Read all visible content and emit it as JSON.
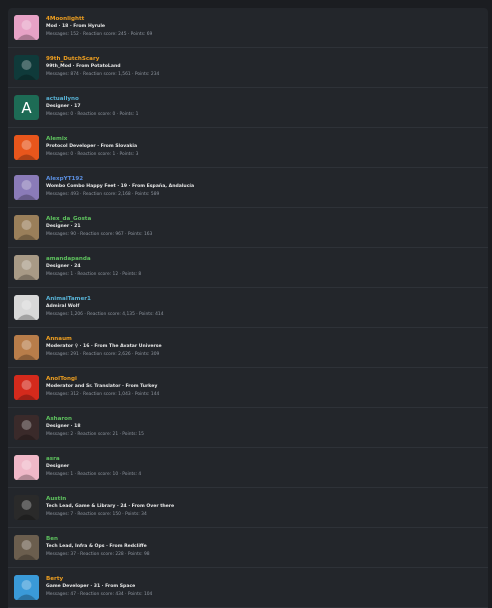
{
  "members": [
    {
      "name": "4Moonlightt",
      "name_color": "#f0a020",
      "title": "Mod · 18 · From Hyrule",
      "stats": "Messages: 152 · Reaction score: 245 · Points: 69",
      "avatar_icon": "anime-girl-pink-avatar",
      "avatar_color": "#e7a2c6"
    },
    {
      "name": "99th_DutchScary",
      "name_color": "#f0a020",
      "title": "99th_Mod · From PotatoLand",
      "stats": "Messages: 874 · Reaction score: 1,561 · Points: 234",
      "avatar_icon": "cheshire-cat-avatar",
      "avatar_color": "#0f3a3a"
    },
    {
      "name": "actuallyno",
      "name_color": "#58b3d6",
      "title": "Designer · 17",
      "stats": "Messages: 0 · Reaction score: 0 · Points: 1",
      "avatar_letter": "A",
      "avatar_color": "#1d6b55"
    },
    {
      "name": "Alemix",
      "name_color": "#5ec25e",
      "title": "Protocol Developer · From Slovakia",
      "stats": "Messages: 0 · Reaction score: 1 · Points: 3",
      "avatar_icon": "flame-a-logo-avatar",
      "avatar_color": "#e8561c"
    },
    {
      "name": "AlexpYT192",
      "name_color": "#5b8fe0",
      "title": "Wombo Combo Happy Feet · 19 · From España, Andalucía",
      "stats": "Messages: 493 · Reaction score: 2,168 · Points: 589",
      "avatar_icon": "game-scene-avatar",
      "avatar_color": "#8a7bb8"
    },
    {
      "name": "Alex_da_Gosta",
      "name_color": "#5ec25e",
      "title": "Designer · 21",
      "stats": "Messages: 90 · Reaction score: 967 · Points: 163",
      "avatar_icon": "character-avatar",
      "avatar_color": "#9a7f5a"
    },
    {
      "name": "amandapanda",
      "name_color": "#5ec25e",
      "title": "Designer · 24",
      "stats": "Messages: 1 · Reaction score: 12 · Points: 8",
      "avatar_icon": "photo-avatar",
      "avatar_color": "#a89a86"
    },
    {
      "name": "AnimalTamer1",
      "name_color": "#58b3d6",
      "title": "Admiral Wolf",
      "stats": "Messages: 1,206 · Reaction score: 4,135 · Points: 414",
      "avatar_icon": "white-wolf-avatar",
      "avatar_color": "#d8d8d8"
    },
    {
      "name": "Annaum",
      "name_color": "#f0a020",
      "title": "Moderator ♀ · 16 · From The Avatar Universe",
      "stats": "Messages: 291 · Reaction score: 2,626 · Points: 309",
      "avatar_icon": "portrait-avatar",
      "avatar_color": "#b87d4a"
    },
    {
      "name": "AnolTongi",
      "name_color": "#f0a020",
      "title": "Moderator and Sr. Translator · From Turkey",
      "stats": "Messages: 312 · Reaction score: 1,043 · Points: 144",
      "avatar_icon": "mario-avatar",
      "avatar_color": "#d42a1c"
    },
    {
      "name": "Asharon",
      "name_color": "#5ec25e",
      "title": "Designer · 18",
      "stats": "Messages: 2 · Reaction score: 21 · Points: 15",
      "avatar_icon": "dark-character-avatar",
      "avatar_color": "#3a2a2a"
    },
    {
      "name": "asra",
      "name_color": "#5ec25e",
      "title": "Designer",
      "stats": "Messages: 1 · Reaction score: 10 · Points: 4",
      "avatar_icon": "pink-art-avatar",
      "avatar_color": "#f0b8c8"
    },
    {
      "name": "Austin",
      "name_color": "#5ec25e",
      "title": "Tech Lead, Game & Library · 24 · From Over there",
      "stats": "Messages: 7 · Reaction score: 150 · Points: 34",
      "avatar_icon": "silhouette-avatar",
      "avatar_color": "#2a2a2a"
    },
    {
      "name": "Ben",
      "name_color": "#5ec25e",
      "title": "Tech Lead, Infra & Ops · From Redcliffe",
      "stats": "Messages: 37 · Reaction score: 228 · Points: 98",
      "avatar_icon": "person-photo-avatar",
      "avatar_color": "#6b5e4e"
    },
    {
      "name": "Berty",
      "name_color": "#f0a020",
      "title": "Game Developer · 31 · From Space",
      "stats": "Messages: 47 · Reaction score: 434 · Points: 104",
      "avatar_icon": "blue-bird-avatar",
      "avatar_color": "#3a9ad8"
    }
  ]
}
